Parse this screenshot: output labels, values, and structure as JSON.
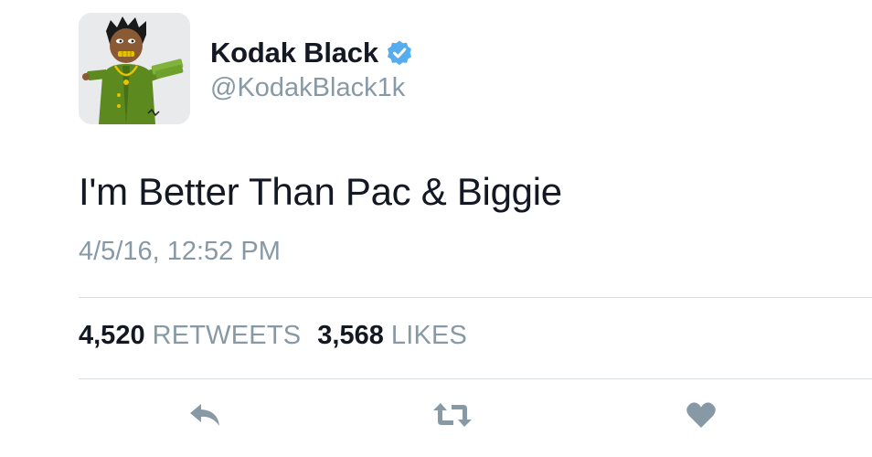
{
  "tweet": {
    "author": {
      "display_name": "Kodak Black",
      "handle": "@KodakBlack1k",
      "verified": true,
      "avatar_icon": "cartoon-avatar"
    },
    "text": "I'm Better Than Pac & Biggie",
    "timestamp": "4/5/16, 12:52 PM",
    "stats": {
      "retweets": {
        "count": "4,520",
        "label": "RETWEETS"
      },
      "likes": {
        "count": "3,568",
        "label": "LIKES"
      }
    },
    "actions": [
      {
        "name": "reply",
        "icon": "reply-icon"
      },
      {
        "name": "retweet",
        "icon": "retweet-icon"
      },
      {
        "name": "like",
        "icon": "heart-icon"
      }
    ]
  },
  "colors": {
    "primary_text": "#141823",
    "secondary_text": "#8899a6",
    "verified_blue": "#55acee",
    "action_icon": "#8899a6",
    "divider": "#d8dde1"
  }
}
